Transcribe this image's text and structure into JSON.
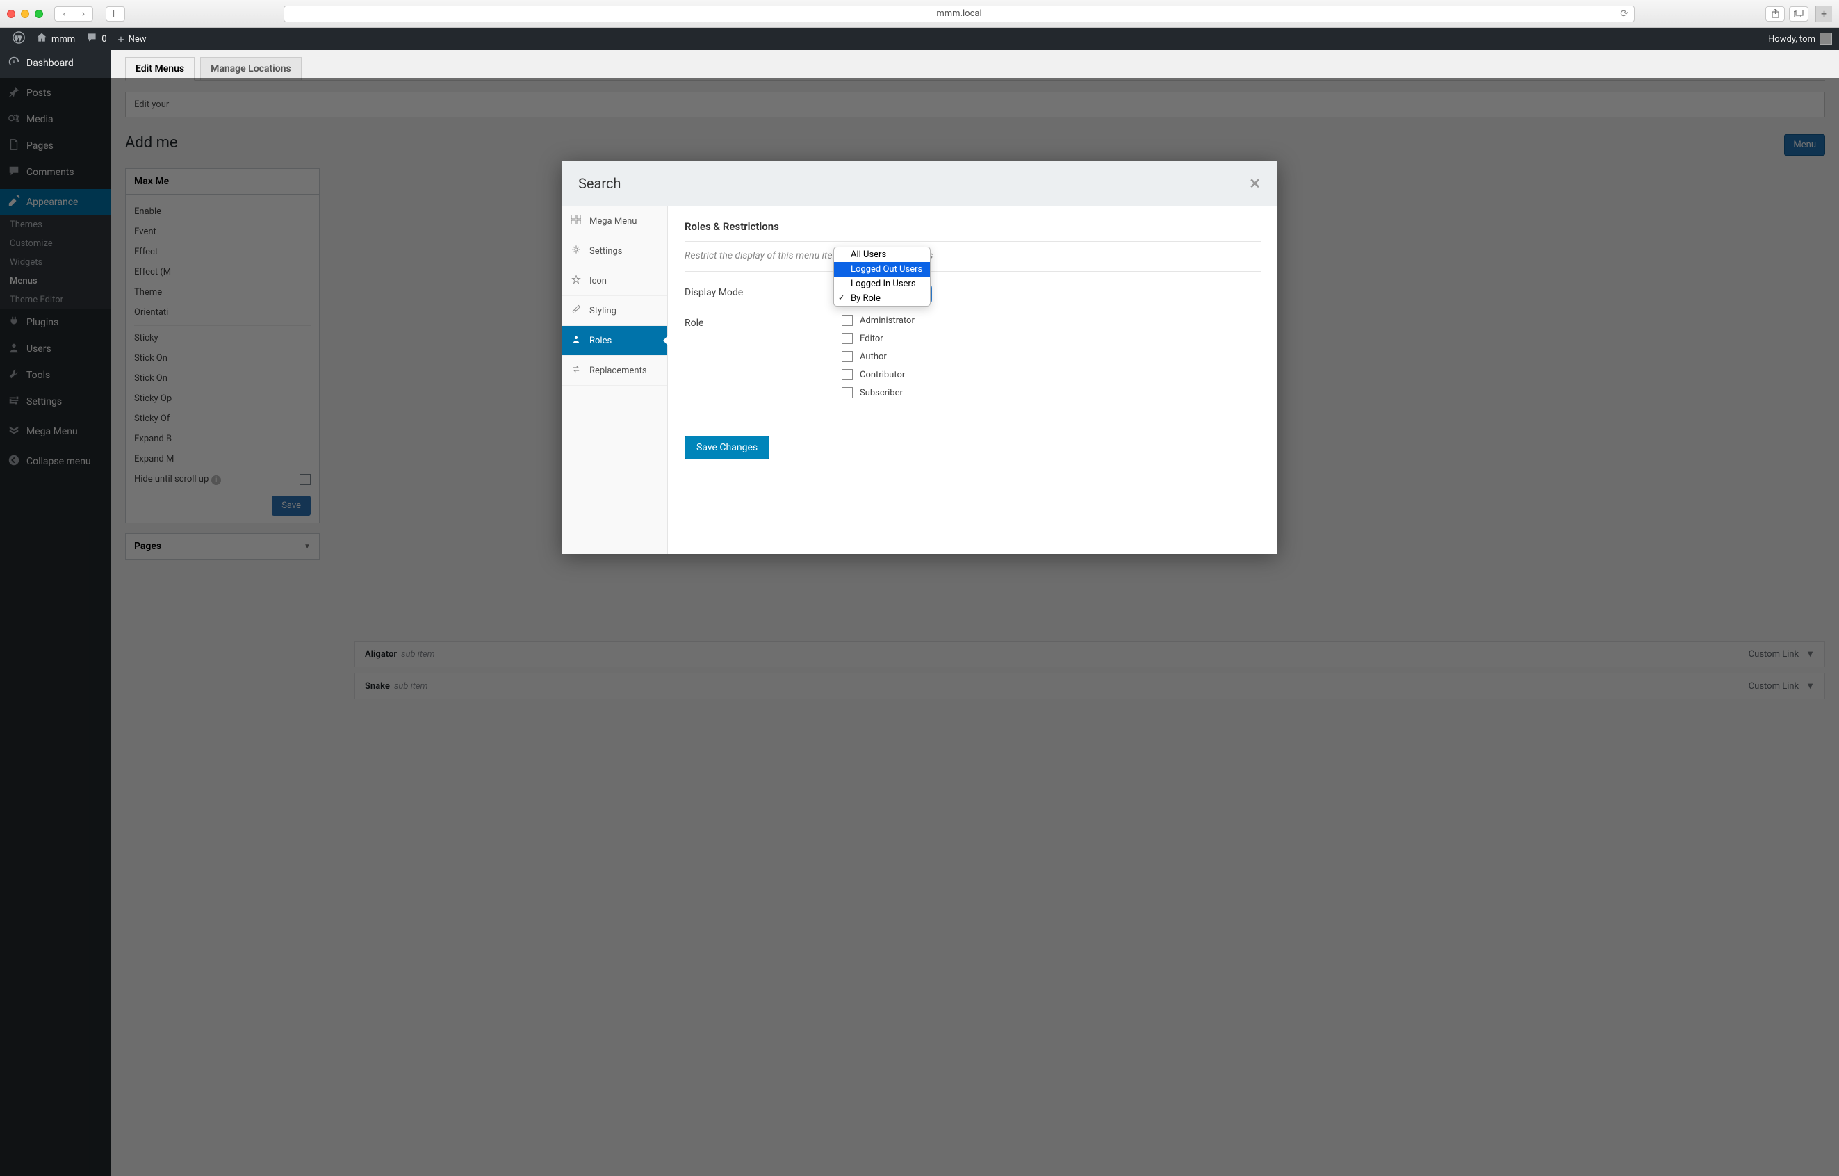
{
  "browser": {
    "url": "mmm.local"
  },
  "adminBar": {
    "siteName": "mmm",
    "commentCount": "0",
    "newLabel": "New",
    "greeting": "Howdy, tom"
  },
  "adminMenu": {
    "items": [
      {
        "label": "Dashboard",
        "icon": "dashboard"
      },
      {
        "label": "Posts",
        "icon": "pin"
      },
      {
        "label": "Media",
        "icon": "media"
      },
      {
        "label": "Pages",
        "icon": "pages"
      },
      {
        "label": "Comments",
        "icon": "comments"
      },
      {
        "label": "Appearance",
        "icon": "appearance",
        "current": true
      },
      {
        "label": "Plugins",
        "icon": "plugin"
      },
      {
        "label": "Users",
        "icon": "users"
      },
      {
        "label": "Tools",
        "icon": "tools"
      },
      {
        "label": "Settings",
        "icon": "settings"
      },
      {
        "label": "Mega Menu",
        "icon": "megamenu"
      },
      {
        "label": "Collapse menu",
        "icon": "collapse"
      }
    ],
    "submenuItems": [
      {
        "label": "Themes"
      },
      {
        "label": "Customize"
      },
      {
        "label": "Widgets"
      },
      {
        "label": "Menus",
        "current": true
      },
      {
        "label": "Theme Editor"
      }
    ]
  },
  "content": {
    "tabs": [
      {
        "label": "Edit Menus",
        "active": true
      },
      {
        "label": "Manage Locations"
      }
    ],
    "editBelow": "Edit your",
    "sectionTitle": "Add me",
    "createMenuBtn": "Menu",
    "maxBox": {
      "title": "Max Me",
      "fields": [
        "Enable",
        "Event",
        "Effect",
        "Effect (M",
        "Theme",
        "Orientati",
        "Sticky",
        "Stick On",
        "Stick On",
        "Sticky Op",
        "Sticky Of",
        "Expand B",
        "Expand M",
        "Hide until scroll up"
      ],
      "saveLabel": "Save"
    },
    "pagesBox": {
      "title": "Pages"
    },
    "menuItems": [
      {
        "title": "Aligator",
        "sub": "sub item",
        "type": "Custom Link"
      },
      {
        "title": "Snake",
        "sub": "sub item",
        "type": "Custom Link"
      }
    ]
  },
  "modal": {
    "title": "Search",
    "tabs": [
      {
        "label": "Mega Menu",
        "icon": "grid"
      },
      {
        "label": "Settings",
        "icon": "gear"
      },
      {
        "label": "Icon",
        "icon": "star"
      },
      {
        "label": "Styling",
        "icon": "brush"
      },
      {
        "label": "Roles",
        "icon": "user",
        "active": true
      },
      {
        "label": "Replacements",
        "icon": "swap"
      }
    ],
    "panel": {
      "heading": "Roles & Restrictions",
      "description": "Restrict the display of this menu item to selected user roles",
      "displayModeLabel": "Display Mode",
      "displayModeOptions": [
        {
          "label": "All Users"
        },
        {
          "label": "Logged Out Users",
          "highlighted": true
        },
        {
          "label": "Logged In Users"
        },
        {
          "label": "By Role",
          "selected": true
        }
      ],
      "roleLabel": "Role",
      "roles": [
        "Administrator",
        "Editor",
        "Author",
        "Contributor",
        "Subscriber"
      ],
      "saveLabel": "Save Changes"
    }
  }
}
